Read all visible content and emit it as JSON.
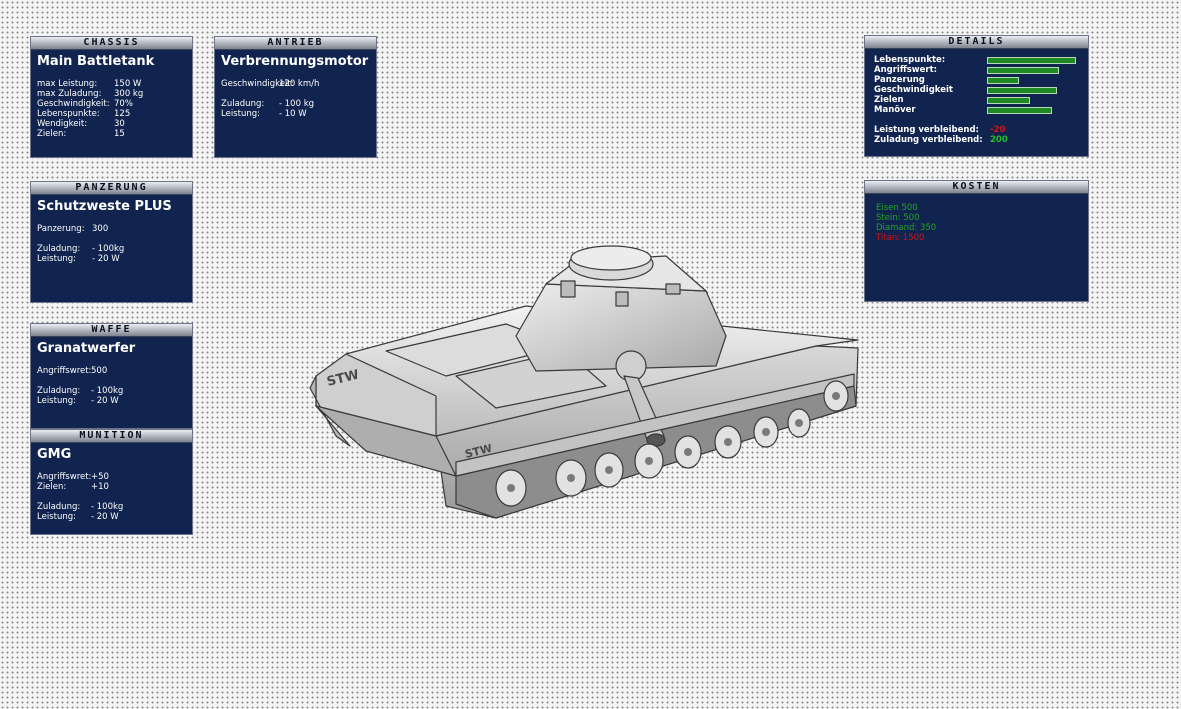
{
  "colors": {
    "panel_bg": "#10244f",
    "bar_fill": "#1f8a23",
    "negative": "#e01010",
    "positive": "#22c322",
    "cost_ok": "#22a322",
    "cost_missing": "#d01515"
  },
  "chassis": {
    "header": "CHASSIS",
    "name": "Main Battletank",
    "stats": [
      {
        "label": "max Leistung:",
        "value": "150 W"
      },
      {
        "label": "max Zuladung:",
        "value": "300 kg"
      },
      {
        "label": "Geschwindigkeit:",
        "value": "70%"
      },
      {
        "label": "Lebenspunkte:",
        "value": "125"
      },
      {
        "label": "Wendigkeit:",
        "value": "30"
      },
      {
        "label": "Zielen:",
        "value": "15"
      }
    ]
  },
  "antrieb": {
    "header": "ANTRIEB",
    "name": "Verbrennungsmotor",
    "stats": [
      {
        "label": "Geschwindigkeit:",
        "value": "120 km/h"
      }
    ],
    "costs": [
      {
        "label": "Zuladung:",
        "value": "- 100 kg"
      },
      {
        "label": "Leistung:",
        "value": "- 10 W"
      }
    ]
  },
  "panzerung": {
    "header": "PANZERUNG",
    "name": "Schutzweste PLUS",
    "stats": [
      {
        "label": "Panzerung:",
        "value": "300"
      }
    ],
    "costs": [
      {
        "label": "Zuladung:",
        "value": "- 100kg"
      },
      {
        "label": "Leistung:",
        "value": "- 20 W"
      }
    ]
  },
  "waffe": {
    "header": "WAFFE",
    "name": "Granatwerfer",
    "stats": [
      {
        "label": "Angriffswret:",
        "value": "500"
      }
    ],
    "costs": [
      {
        "label": "Zuladung:",
        "value": "- 100kg"
      },
      {
        "label": "Leistung:",
        "value": "- 20 W"
      }
    ]
  },
  "munition": {
    "header": "MUNITION",
    "name": "GMG",
    "stats": [
      {
        "label": "Angriffswret:",
        "value": "+50"
      },
      {
        "label": "Zielen:",
        "value": "+10"
      }
    ],
    "costs": [
      {
        "label": "Zuladung:",
        "value": "- 100kg"
      },
      {
        "label": "Leistung:",
        "value": "- 20 W"
      }
    ]
  },
  "details": {
    "header": "DETAILS",
    "bars": [
      {
        "label": "Lebenspunkte:",
        "level": 0.97
      },
      {
        "label": "Angriffswert:",
        "level": 0.78
      },
      {
        "label": "Panzerung",
        "level": 0.34
      },
      {
        "label": "Geschwindigkeit",
        "level": 0.76
      },
      {
        "label": "Zielen",
        "level": 0.46
      },
      {
        "label": "Manöver",
        "level": 0.7
      }
    ],
    "leistung_label": "Leistung verbleibend:",
    "leistung_value": "-20",
    "zuladung_label": "Zuladung verbleibend:",
    "zuladung_value": "200"
  },
  "kosten": {
    "header": "KOSTEN",
    "items": [
      {
        "text": "Eisen 500",
        "affordable": true
      },
      {
        "text": "Stein: 500",
        "affordable": true
      },
      {
        "text": "Diamand: 350",
        "affordable": true
      },
      {
        "text": "Titan: 1500",
        "affordable": false
      }
    ]
  },
  "tank": {
    "hull_markings": [
      "STW",
      "STW"
    ]
  }
}
